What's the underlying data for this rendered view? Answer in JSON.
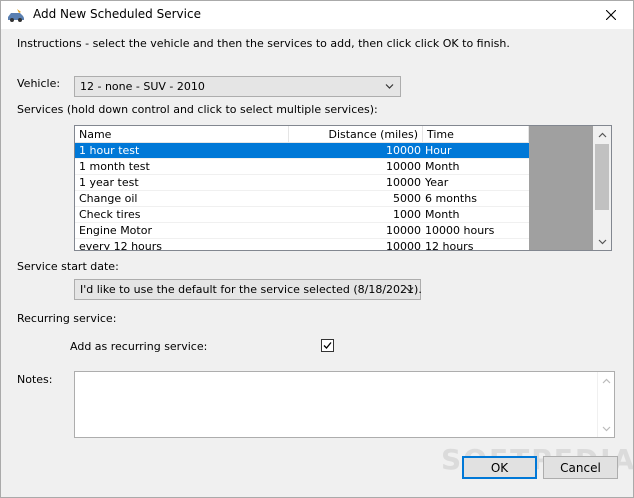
{
  "window": {
    "title": "Add New Scheduled Service",
    "close_icon": "close-icon",
    "app_icon": "car-service-icon"
  },
  "instructions": "Instructions - select the vehicle and then the services to add, then click click OK to finish.",
  "vehicle": {
    "label": "Vehicle:",
    "selected": "12 - none - SUV - 2010"
  },
  "services": {
    "label": "Services (hold down control and click to select multiple services):",
    "columns": [
      "Name",
      "Distance (miles)",
      "Time"
    ],
    "rows": [
      {
        "name": "1 hour test",
        "distance": "10000",
        "time": "Hour",
        "selected": true
      },
      {
        "name": "1 month test",
        "distance": "10000",
        "time": "Month",
        "selected": false
      },
      {
        "name": "1 year test",
        "distance": "10000",
        "time": "Year",
        "selected": false
      },
      {
        "name": "Change oil",
        "distance": "5000",
        "time": "6 months",
        "selected": false
      },
      {
        "name": "Check tires",
        "distance": "1000",
        "time": "Month",
        "selected": false
      },
      {
        "name": "Engine Motor",
        "distance": "10000",
        "time": "10000 hours",
        "selected": false
      },
      {
        "name": "every 12 hours",
        "distance": "10000",
        "time": "12 hours",
        "selected": false
      }
    ]
  },
  "start_date": {
    "label": "Service start date:",
    "selected": "I'd like to use the default for the service selected (8/18/2021)."
  },
  "recurring": {
    "label": "Recurring service:",
    "checkbox_label": "Add as recurring service:",
    "checked": true
  },
  "notes": {
    "label": "Notes:",
    "value": ""
  },
  "buttons": {
    "ok": "OK",
    "cancel": "Cancel"
  },
  "watermark": "SOFTPEDIA",
  "colors": {
    "selection": "#0078d7",
    "window_bg": "#f0f0f0"
  }
}
